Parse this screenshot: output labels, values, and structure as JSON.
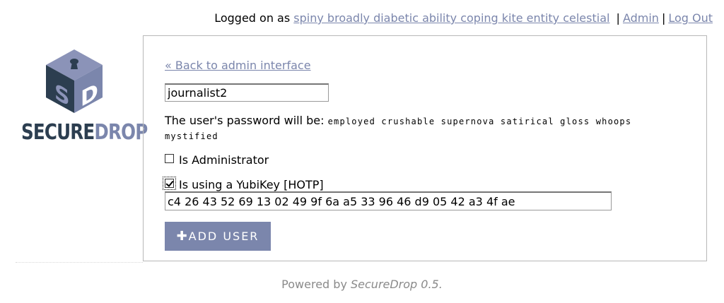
{
  "header": {
    "logged_on_prefix": "Logged on as",
    "username_link": "spiny broadly diabetic ability coping kite entity celestial",
    "separator": "|",
    "admin_link": "Admin",
    "logout_link": "Log Out"
  },
  "logo": {
    "word_secure": "SECURE",
    "word_drop": "DROP",
    "cube_letters": [
      "S",
      "D"
    ]
  },
  "form": {
    "back_link": "« Back to admin interface",
    "username_value": "journalist2",
    "password_label": "The user's password will be:",
    "password_value": "employed crushable supernova satirical gloss whoops mystified",
    "admin_checkbox": {
      "label": "Is Administrator",
      "checked": false
    },
    "yubikey_checkbox": {
      "label": "Is using a YubiKey [HOTP]",
      "checked": true
    },
    "hotp_secret_value": "c4 26 43 52 69 13 02 49 9f 6a a5 33 96 46 d9 05 42 a3 4f ae",
    "submit_icon": "plus-icon",
    "submit_label": "ADD USER"
  },
  "footer": {
    "powered_by": "Powered by",
    "product": "SecureDrop 0.5."
  },
  "colors": {
    "accent": "#7b86ac",
    "logo_dark": "#2c3e50",
    "cube_top": "#8b93b8",
    "cube_left": "#2c3e50",
    "cube_right": "#7b86ac"
  }
}
